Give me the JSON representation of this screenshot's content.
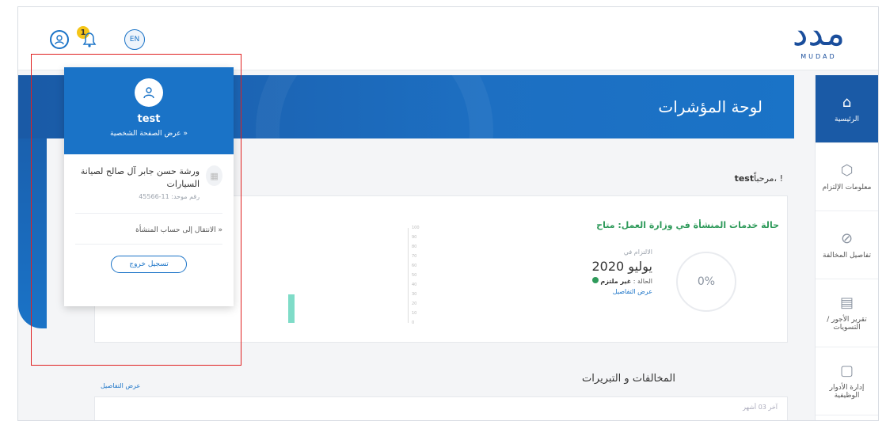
{
  "header": {
    "notification_count": "1",
    "language": "EN",
    "logo_sub": "MUDAD"
  },
  "banner": {
    "title": "لوحة المؤشرات"
  },
  "sidebar": {
    "items": [
      {
        "label": "الرئيسية",
        "icon": "home-icon"
      },
      {
        "label": "معلومات الإلتزام",
        "icon": "compliance-icon"
      },
      {
        "label": "تفاصيل المخالفة",
        "icon": "violation-icon"
      },
      {
        "label": "تقرير الأجور / التسويات",
        "icon": "report-icon"
      },
      {
        "label": "إدارة الأدوار الوظيفية",
        "icon": "roles-icon"
      }
    ]
  },
  "main": {
    "welcome_name": "test",
    "welcome_text": "مرحباً، !",
    "status_title": "حالة خدمات المنشأة في وزارة العمل: متاح",
    "commitment_label": "الالتزام في",
    "month": "يوليو 2020",
    "state_label": "الحالة :",
    "state_value": "غير ملتزم",
    "view_details": "عرض التفاصيل",
    "gauge_value": "0%",
    "violations_title": "المخالفات و التبريرات",
    "violations_link": "عرض التفاصيل",
    "bottom_text": "آخر 03 أشهر"
  },
  "dropdown": {
    "username": "test",
    "view_profile": "عرض الصفحة الشخصية »",
    "org_name": "ورشة حسن جابر آل صالح لصيانة السيارات",
    "org_number": "رقم موحد: 11-45566",
    "switch_label": "الانتقال إلى حساب المنشأة »",
    "logout_label": "تسجيل خروج"
  },
  "chart_data": {
    "type": "bar",
    "categories": [
      ""
    ],
    "values": [
      30
    ],
    "ylim": [
      0,
      100
    ],
    "ticks": [
      "100",
      "90",
      "80",
      "70",
      "60",
      "50",
      "40",
      "30",
      "20",
      "10",
      "0"
    ]
  },
  "colors": {
    "primary": "#1a73c7",
    "success": "#2e9a5a",
    "accent": "#f5c518",
    "highlight": "#e02020"
  }
}
